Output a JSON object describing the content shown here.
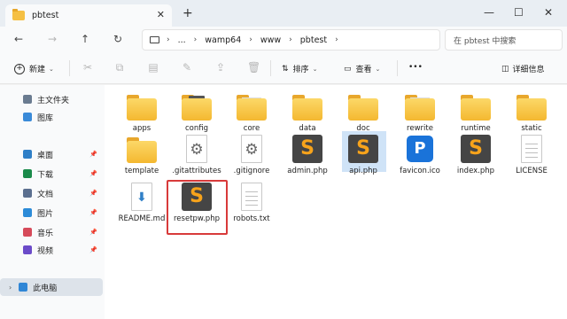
{
  "window": {
    "tab_title": "pbtest",
    "tab_close": "✕",
    "new_tab": "+",
    "controls": [
      "—",
      "☐",
      "✕"
    ]
  },
  "nav": {
    "back": "←",
    "forward": "→",
    "up": "↑",
    "refresh": "↻",
    "breadcrumb": [
      "...",
      "wamp64",
      "www",
      "pbtest"
    ],
    "search_placeholder": "在 pbtest 中搜索"
  },
  "toolbar": {
    "new_label": "新建",
    "sort_label": "排序",
    "view_label": "查看",
    "more_label": "•••",
    "details_label": "详细信息"
  },
  "sidebar": {
    "top_items": [
      {
        "label": "主文件夹",
        "icon": "home-icon"
      },
      {
        "label": "图库",
        "icon": "gallery-icon"
      }
    ],
    "pinned_items": [
      {
        "label": "桌面",
        "icon": "desktop-icon",
        "color": "#2f7fc7"
      },
      {
        "label": "下载",
        "icon": "download-icon",
        "color": "#1a8a4a"
      },
      {
        "label": "文档",
        "icon": "documents-icon",
        "color": "#5b6f8f"
      },
      {
        "label": "图片",
        "icon": "pictures-icon",
        "color": "#2c8bd8"
      },
      {
        "label": "音乐",
        "icon": "music-icon",
        "color": "#d64a5a"
      },
      {
        "label": "视频",
        "icon": "videos-icon",
        "color": "#6b4bc9"
      }
    ],
    "this_pc": "此电脑"
  },
  "files": [
    {
      "name": "apps",
      "type": "folder"
    },
    {
      "name": "config",
      "type": "folder-img"
    },
    {
      "name": "core",
      "type": "folder-doc"
    },
    {
      "name": "data",
      "type": "folder"
    },
    {
      "name": "doc",
      "type": "folder"
    },
    {
      "name": "rewrite",
      "type": "folder-doc"
    },
    {
      "name": "runtime",
      "type": "folder"
    },
    {
      "name": "static",
      "type": "folder"
    },
    {
      "name": "template",
      "type": "folder"
    },
    {
      "name": ".gitattributes",
      "type": "gear"
    },
    {
      "name": ".gitignore",
      "type": "gear"
    },
    {
      "name": "admin.php",
      "type": "sublime"
    },
    {
      "name": "api.php",
      "type": "sublime",
      "selected": true
    },
    {
      "name": "favicon.ico",
      "type": "favicon"
    },
    {
      "name": "index.php",
      "type": "sublime"
    },
    {
      "name": "LICENSE",
      "type": "text"
    },
    {
      "name": "README.md",
      "type": "readme"
    },
    {
      "name": "resetpw.php",
      "type": "sublime",
      "highlighted": true
    },
    {
      "name": "robots.txt",
      "type": "text"
    }
  ]
}
